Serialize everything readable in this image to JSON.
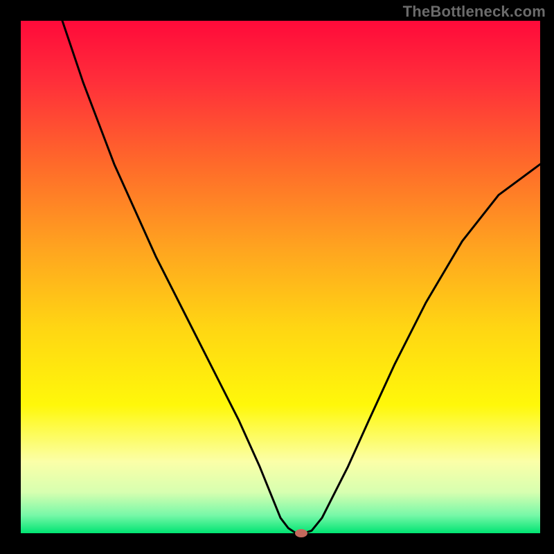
{
  "watermark": "TheBottleneck.com",
  "plot": {
    "inner_x": 30,
    "inner_y": 30,
    "inner_w": 750,
    "inner_h": 740,
    "gradient_stops": [
      {
        "offset": 0.0,
        "color": "#ff0a3a"
      },
      {
        "offset": 0.12,
        "color": "#ff2f3a"
      },
      {
        "offset": 0.28,
        "color": "#ff6a2a"
      },
      {
        "offset": 0.45,
        "color": "#ffa61f"
      },
      {
        "offset": 0.6,
        "color": "#ffd613"
      },
      {
        "offset": 0.75,
        "color": "#fff80a"
      },
      {
        "offset": 0.86,
        "color": "#fbffa8"
      },
      {
        "offset": 0.92,
        "color": "#d7ffb0"
      },
      {
        "offset": 0.965,
        "color": "#77f8a8"
      },
      {
        "offset": 1.0,
        "color": "#00e472"
      }
    ],
    "curve_color": "#000000",
    "curve_width": 3,
    "marker": {
      "color": "#c4695d",
      "rx": 9,
      "ry": 6
    }
  },
  "chart_data": {
    "type": "line",
    "title": "",
    "xlabel": "",
    "ylabel": "",
    "xlim": [
      0,
      100
    ],
    "ylim": [
      0,
      100
    ],
    "grid": false,
    "legend": false,
    "series": [
      {
        "name": "bottleneck-curve",
        "x": [
          8,
          10,
          12,
          15,
          18,
          22,
          26,
          30,
          34,
          38,
          42,
          46,
          48,
          50,
          51.5,
          53,
          54.5,
          56,
          58,
          60,
          63,
          67,
          72,
          78,
          85,
          92,
          100
        ],
        "y": [
          100,
          94,
          88,
          80,
          72,
          63,
          54,
          46,
          38,
          30,
          22,
          13,
          8,
          3,
          1,
          0,
          0,
          0.5,
          3,
          7,
          13,
          22,
          33,
          45,
          57,
          66,
          72
        ]
      }
    ],
    "marker_point": {
      "x": 54,
      "y": 0
    },
    "background": "vertical-gradient red→yellow→green (green at bottom)"
  }
}
